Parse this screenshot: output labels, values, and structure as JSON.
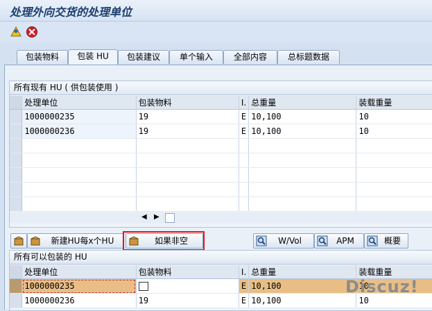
{
  "window_title": "处理外向交货的处理单位",
  "toolbar": {
    "icons": [
      "pack-icon",
      "cancel-icon"
    ]
  },
  "tabs": [
    {
      "label": "包装物料",
      "active": false
    },
    {
      "label": "包装 HU",
      "active": true
    },
    {
      "label": "包装建议",
      "active": false
    },
    {
      "label": "单个输入",
      "active": false
    },
    {
      "label": "全部内容",
      "active": false
    },
    {
      "label": "总标题数据",
      "active": false
    }
  ],
  "existing_hu": {
    "title": "所有现有 HU ( 供包装使用 )",
    "columns": [
      "处理单位",
      "包装物料",
      "I.",
      "总重量",
      "装载重量"
    ],
    "rows": [
      {
        "hu": "1000000235",
        "material": "19",
        "ind": "E",
        "gross": "10,100",
        "load": "10"
      },
      {
        "hu": "1000000236",
        "material": "19",
        "ind": "E",
        "gross": "10,100",
        "load": "10"
      }
    ]
  },
  "buttons": {
    "new_hu": "新建HU每x个HU",
    "if_not_empty": "如果非空",
    "wvol": "W/Vol",
    "apm": "APM",
    "overview": "概要"
  },
  "packable_hu": {
    "title": "所有可以包装的 HU",
    "columns": [
      "处理单位",
      "包装物料",
      "I.",
      "总重量",
      "装载重量"
    ],
    "rows": [
      {
        "hu": "1000000235",
        "material": "",
        "ind": "E",
        "gross": "10,100",
        "load": "10"
      },
      {
        "hu": "1000000236",
        "material": "19",
        "ind": "E",
        "gross": "10,100",
        "load": "10"
      }
    ]
  },
  "watermark": "Discuz!"
}
